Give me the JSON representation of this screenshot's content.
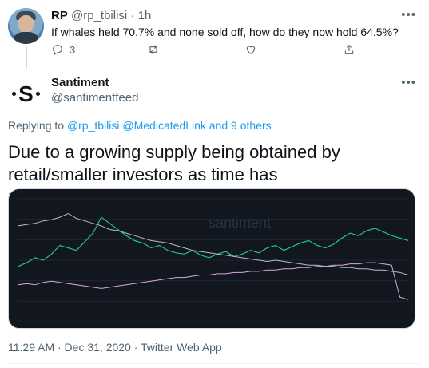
{
  "reply_tweet": {
    "name": "RP",
    "handle": "@rp_tbilisi",
    "separator": "·",
    "time": "1h",
    "text": "If whales held 70.7% and none sold off, how do they now hold 64.5%?",
    "actions": {
      "reply_count": "3",
      "retweet_count": "",
      "like_count": ""
    },
    "icons": [
      "reply-icon",
      "retweet-icon",
      "like-icon",
      "share-icon",
      "more-icon"
    ]
  },
  "main_tweet": {
    "name": "Santiment",
    "handle": "@santimentfeed",
    "avatar_letter": "S",
    "replying_prefix": "Replying to ",
    "replying_users": "@rp_tbilisi @MedicatedLink",
    "replying_suffix": " and 9 others",
    "text": "Due to a growing supply being obtained by retail/smaller investors as time has progressed!",
    "timestamp": "11:29 AM · Dec 31, 2020 · Twitter Web App"
  },
  "colors": {
    "accent": "#1d9bf0",
    "chart_bg": "#12161f",
    "price_line": "#26c281",
    "supply_line_1": "#b9b9c8",
    "supply_line_2": "#d8a8e0"
  },
  "chart_data": {
    "type": "line",
    "title": "",
    "watermark": "santiment",
    "xlabel": "",
    "ylabel": "",
    "series": [
      {
        "name": "",
        "values": [
          45,
          48,
          52,
          50,
          55,
          62,
          60,
          58,
          65,
          72,
          85,
          80,
          75,
          70,
          66,
          64,
          60,
          62,
          58,
          56,
          55,
          58,
          54,
          52,
          55,
          57,
          53,
          55,
          58,
          56,
          60,
          62,
          58,
          61,
          64,
          66,
          62,
          60,
          63,
          68,
          72,
          70,
          74,
          76,
          73,
          70,
          68,
          66
        ]
      },
      {
        "name": "",
        "values": [
          78,
          79,
          80,
          82,
          83,
          85,
          88,
          84,
          82,
          80,
          78,
          75,
          74,
          72,
          70,
          68,
          66,
          65,
          64,
          62,
          60,
          58,
          57,
          56,
          55,
          54,
          53,
          52,
          51,
          50,
          49,
          50,
          49,
          48,
          47,
          46,
          46,
          45,
          45,
          44,
          44,
          43,
          43,
          42,
          42,
          41,
          40,
          38
        ]
      },
      {
        "name": "",
        "values": [
          30,
          31,
          30,
          32,
          33,
          32,
          31,
          30,
          29,
          28,
          27,
          28,
          29,
          30,
          31,
          32,
          33,
          34,
          35,
          36,
          36,
          37,
          38,
          38,
          39,
          39,
          40,
          40,
          41,
          41,
          42,
          42,
          43,
          43,
          44,
          44,
          45,
          45,
          46,
          46,
          47,
          47,
          48,
          48,
          47,
          46,
          20,
          18
        ]
      }
    ],
    "ylim": [
      0,
      100
    ],
    "grid": true,
    "legend": "top-left"
  }
}
